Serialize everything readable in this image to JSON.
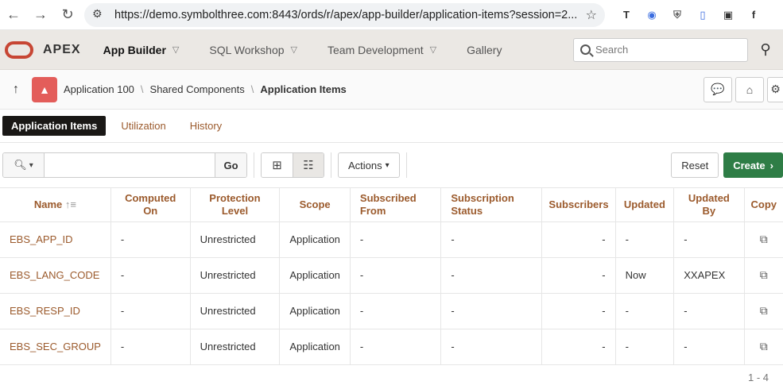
{
  "browser": {
    "url": "https://demo.symbolthree.com:8443/ords/r/apex/app-builder/application-items?session=2..."
  },
  "header": {
    "product": "APEX",
    "menus": [
      "App Builder",
      "SQL Workshop",
      "Team Development",
      "Gallery"
    ],
    "search_placeholder": "Search"
  },
  "breadcrumb": {
    "items": [
      "Application 100",
      "Shared Components",
      "Application Items"
    ]
  },
  "tabs": [
    "Application Items",
    "Utilization",
    "History"
  ],
  "toolbar": {
    "go": "Go",
    "actions": "Actions",
    "reset": "Reset",
    "create": "Create"
  },
  "table": {
    "headers": [
      [
        "Name"
      ],
      [
        "Computed",
        "On"
      ],
      [
        "Protection",
        "Level"
      ],
      [
        "Scope"
      ],
      [
        "Subscribed",
        "From"
      ],
      [
        "Subscription",
        "Status"
      ],
      [
        "Subscribers"
      ],
      [
        "Updated"
      ],
      [
        "Updated",
        "By"
      ],
      [
        "Copy"
      ]
    ],
    "rows": [
      {
        "name": "EBS_APP_ID",
        "computed": "-",
        "protection": "Unrestricted",
        "scope": "Application",
        "sub_from": "-",
        "sub_status": "-",
        "subscribers": "-",
        "updated": "-",
        "updated_by": "-"
      },
      {
        "name": "EBS_LANG_CODE",
        "computed": "-",
        "protection": "Unrestricted",
        "scope": "Application",
        "sub_from": "-",
        "sub_status": "-",
        "subscribers": "-",
        "updated": "Now",
        "updated_by": "XXAPEX"
      },
      {
        "name": "EBS_RESP_ID",
        "computed": "-",
        "protection": "Unrestricted",
        "scope": "Application",
        "sub_from": "-",
        "sub_status": "-",
        "subscribers": "-",
        "updated": "-",
        "updated_by": "-"
      },
      {
        "name": "EBS_SEC_GROUP",
        "computed": "-",
        "protection": "Unrestricted",
        "scope": "Application",
        "sub_from": "-",
        "sub_status": "-",
        "subscribers": "-",
        "updated": "-",
        "updated_by": "-"
      }
    ],
    "pagination": "1 - 4"
  },
  "colors": {
    "accent": "#9b5a2c",
    "create": "#2e7d46",
    "logo": "#c74634"
  }
}
